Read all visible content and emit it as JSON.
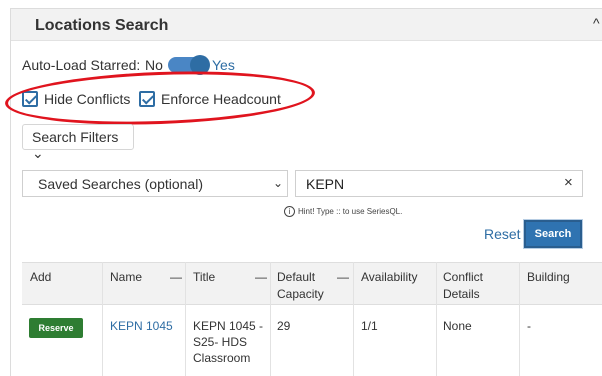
{
  "panel": {
    "title": "Locations Search",
    "collapse_icon": "caret-up-icon"
  },
  "autoload": {
    "label": "Auto-Load Starred:",
    "no": "No",
    "yes": "Yes",
    "value": "Yes"
  },
  "options": [
    {
      "label": "Hide Conflicts",
      "checked": true
    },
    {
      "label": "Enforce Headcount",
      "checked": true
    }
  ],
  "filters": {
    "button_label": "Search Filters",
    "caret": "⌄"
  },
  "saved_searches": {
    "selected": "Saved Searches (optional)",
    "caret": "⌄"
  },
  "search": {
    "value": "KEPN",
    "clear": "×",
    "hint_icon": "i",
    "hint": "Hint! Type :: to use SeriesQL."
  },
  "actions": {
    "reset": "Reset",
    "search": "Search"
  },
  "table": {
    "columns": {
      "add": "Add",
      "name": "Name",
      "title": "Title",
      "capacity_line1": "Default",
      "capacity_line2": "Capacity",
      "availability": "Availability",
      "conflict_line1": "Conflict",
      "conflict_line2": "Details",
      "building": "Building",
      "sort_icon": "—"
    },
    "rows": [
      {
        "add": "Reserve",
        "name": "KEPN 1045",
        "title_line1": "KEPN 1045 -",
        "title_line2": "S25- HDS",
        "title_line3": "Classroom",
        "capacity": "29",
        "availability": "1/1",
        "conflict": "None",
        "building": "-"
      }
    ]
  },
  "colors": {
    "accent": "#2e6da4",
    "reserve": "#2e7d32",
    "annotation": "#e0141e"
  }
}
